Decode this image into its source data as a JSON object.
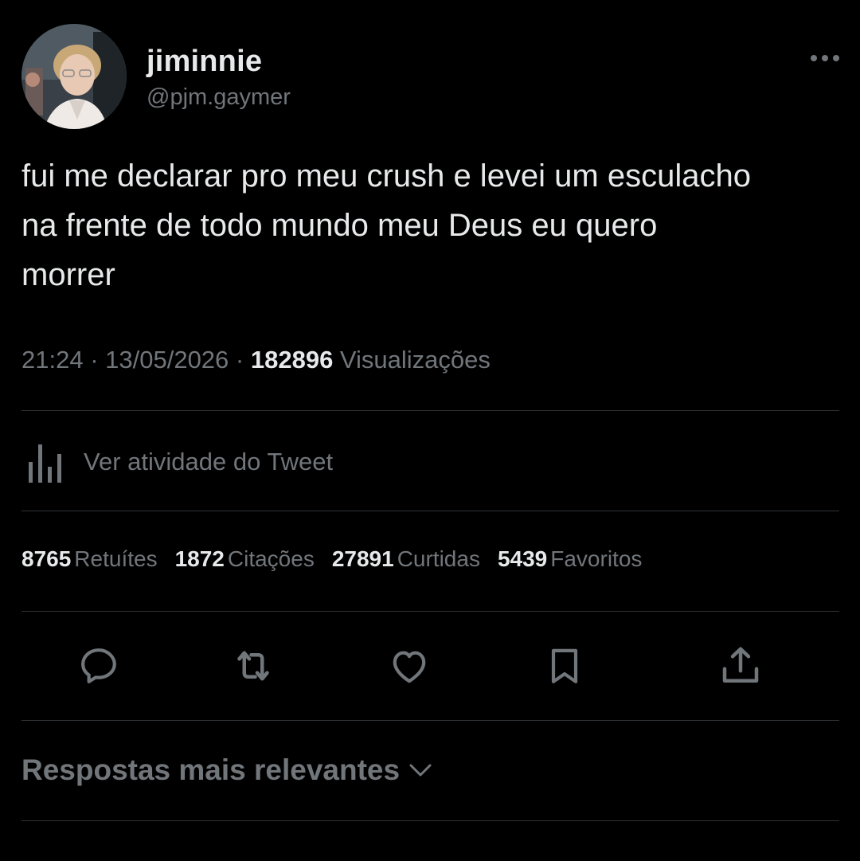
{
  "author": {
    "display_name": "jiminnie",
    "handle": "@pjm.gaymer"
  },
  "tweet": {
    "text": "fui me declarar pro meu crush e levei um esculacho\nna frente de todo mundo meu Deus eu quero\nmorrer"
  },
  "meta": {
    "time": "21:24",
    "sep1": " · ",
    "date": "13/05/2026",
    "sep2": " · ",
    "views_count": "182896",
    "views_label": " Visualizações"
  },
  "activity": {
    "label": "Ver atividade do Tweet"
  },
  "stats": [
    {
      "count": "8765",
      "label": "Retuítes"
    },
    {
      "count": "1872",
      "label": "Citações"
    },
    {
      "count": "27891",
      "label": "Curtidas"
    },
    {
      "count": "5439",
      "label": "Favoritos"
    }
  ],
  "actions": {
    "reply": "reply-icon",
    "retweet": "retweet-icon",
    "like": "heart-icon",
    "bookmark": "bookmark-icon",
    "share": "share-icon"
  },
  "replies": {
    "label": "Respostas mais relevantes"
  },
  "colors": {
    "background": "#000000",
    "text_primary": "#e7e9ea",
    "text_secondary": "#71767b",
    "divider": "#2f3336"
  }
}
